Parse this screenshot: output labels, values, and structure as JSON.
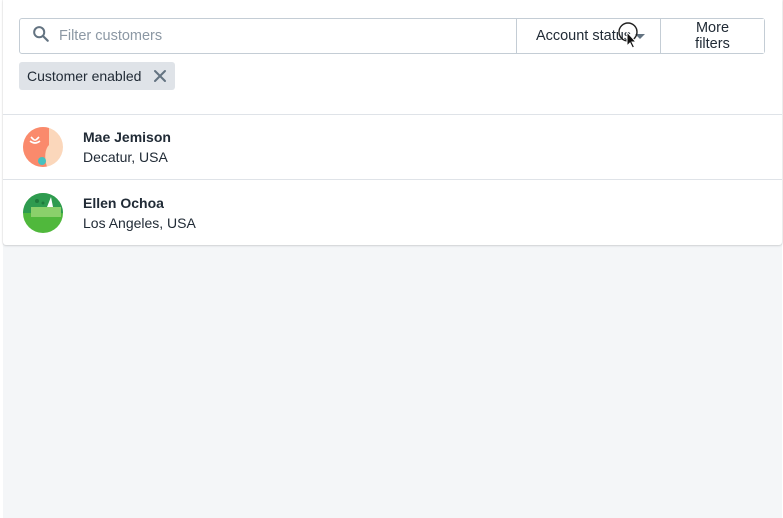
{
  "filters": {
    "search_placeholder": "Filter customers",
    "search_value": "",
    "account_status_label": "Account status",
    "more_filters_label": "More filters"
  },
  "applied_tags": [
    {
      "label": "Customer enabled"
    }
  ],
  "customers": [
    {
      "name": "Mae Jemison",
      "location": "Decatur, USA",
      "avatar": "avatar-orange"
    },
    {
      "name": "Ellen Ochoa",
      "location": "Los Angeles, USA",
      "avatar": "avatar-green"
    }
  ],
  "colors": {
    "border": "#c4cdd5",
    "tag_bg": "#dfe3e8",
    "page_bg": "#f4f6f8",
    "text": "#212b36"
  }
}
